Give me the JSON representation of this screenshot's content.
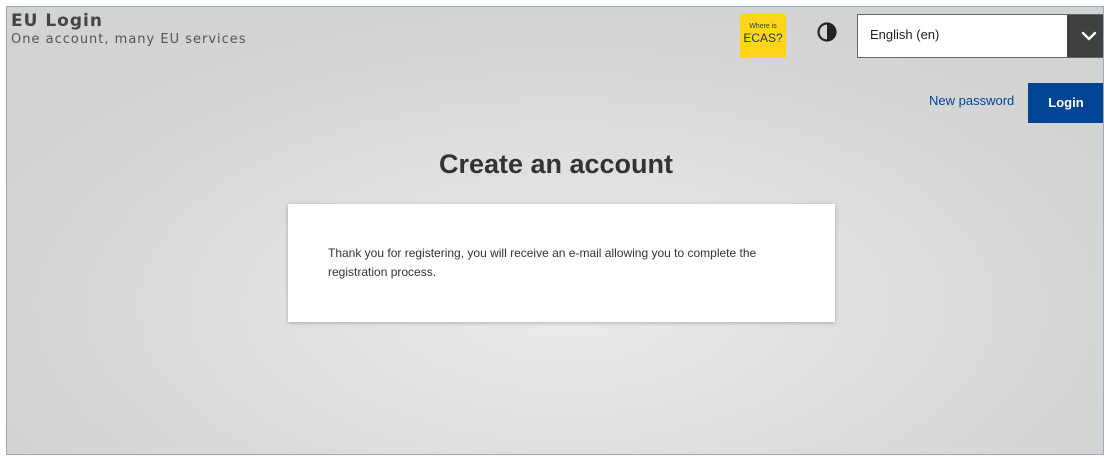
{
  "header": {
    "brand_title": "EU Login",
    "brand_tagline": "One account, many EU services",
    "ecas_badge": {
      "line1": "Where is",
      "line2": "ECAS?",
      "color": "#ffd617"
    },
    "contrast_icon": "contrast-icon",
    "language_select": {
      "selected": "English (en)",
      "arrow_icon": "chevron-down-icon"
    }
  },
  "nav": {
    "new_password": "New password",
    "login": "Login"
  },
  "main": {
    "title": "Create an account",
    "message": "Thank you for registering, you will receive an e-mail allowing you to complete the registration process."
  },
  "colors": {
    "accent": "#004494",
    "badge": "#ffd617",
    "select_arrow_bg": "#404040"
  }
}
